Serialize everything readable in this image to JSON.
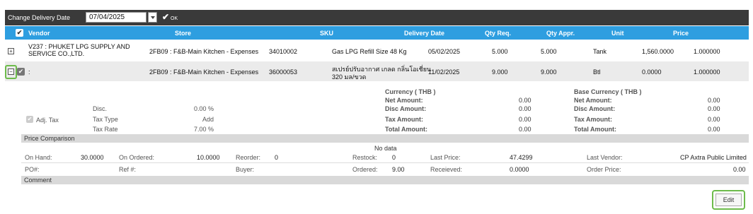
{
  "toolbar": {
    "change_delivery_label": "Change Delivery Date",
    "date_value": "07/04/2025",
    "ok_label": "OK"
  },
  "columns": {
    "vendor": "Vendor",
    "store": "Store",
    "sku": "SKU",
    "delivery_date": "Delivery Date",
    "qty_req": "Qty Req.",
    "qty_appr": "Qty Appr.",
    "unit": "Unit",
    "price": "Price"
  },
  "rows": [
    {
      "expander": "+",
      "vendor_line1": "V237 : PHUKET LPG SUPPLY AND",
      "vendor_line2": "SERVICE CO.,LTD.",
      "store": "2FB09 : F&B-Main Kitchen - Expenses",
      "sku_code": "34010002",
      "sku_name": "Gas LPG Refill Size 48 Kg",
      "sku_name2": "",
      "delivery_date": "05/02/2025",
      "qty_req": "5.000",
      "qty_appr": "5.000",
      "unit": "Tank",
      "price": "1,560.0000",
      "extra": "1.000000"
    },
    {
      "expander": "−",
      "vendor_line1": ":",
      "vendor_line2": "",
      "store": "2FB09 : F&B-Main Kitchen - Expenses",
      "sku_code": "36000053",
      "sku_name": "สเปรย์ปรับอากาศ เกลด กลิ่นโอเชี่ยน",
      "sku_name2": "320 มล/ขวด",
      "delivery_date": "11/02/2025",
      "qty_req": "9.000",
      "qty_appr": "9.000",
      "unit": "Btl",
      "price": "0.0000",
      "extra": "1.000000"
    }
  ],
  "detail": {
    "adj_tax_label": "Adj. Tax",
    "disc_label": "Disc.",
    "disc_value": "0.00 %",
    "tax_type_label": "Tax Type",
    "tax_type_value": "Add",
    "tax_rate_label": "Tax Rate",
    "tax_rate_value": "7.00 %",
    "currency_title": "Currency ( THB )",
    "base_currency_title": "Base Currency ( THB )",
    "net_amount_label": "Net Amount:",
    "disc_amount_label": "Disc Amount:",
    "tax_amount_label": "Tax Amount:",
    "total_amount_label": "Total Amount:",
    "net_amount": "0.00",
    "disc_amount": "0.00",
    "tax_amount": "0.00",
    "total_amount": "0.00",
    "base_net_amount": "0.00",
    "base_disc_amount": "0.00",
    "base_tax_amount": "0.00",
    "base_total_amount": "0.00"
  },
  "price_comparison": {
    "title": "Price Comparison",
    "no_data": "No data"
  },
  "stock": {
    "on_hand_label": "On Hand:",
    "on_hand": "30.0000",
    "on_ordered_label": "On Ordered:",
    "on_ordered": "10.0000",
    "reorder_label": "Reorder:",
    "reorder": "0",
    "restock_label": "Restock:",
    "restock": "0",
    "last_price_label": "Last Price:",
    "last_price": "47.4299",
    "last_vendor_label": "Last Vendor:",
    "last_vendor": "CP Axtra Public Limited",
    "po_label": "PO#:",
    "ref_label": "Ref #:",
    "buyer_label": "Buyer:",
    "ordered_label": "Ordered:",
    "ordered": "9.00",
    "received_label": "Receieved:",
    "received": "0.0000",
    "order_price_label": "Order Price:",
    "order_price": "0.00"
  },
  "comment": {
    "title": "Comment"
  },
  "actions": {
    "edit_label": "Edit"
  },
  "colors": {
    "header_blue": "#2e9ee0",
    "toolbar_dark": "#3a3a3a",
    "focus_green": "#6dbb4b"
  }
}
